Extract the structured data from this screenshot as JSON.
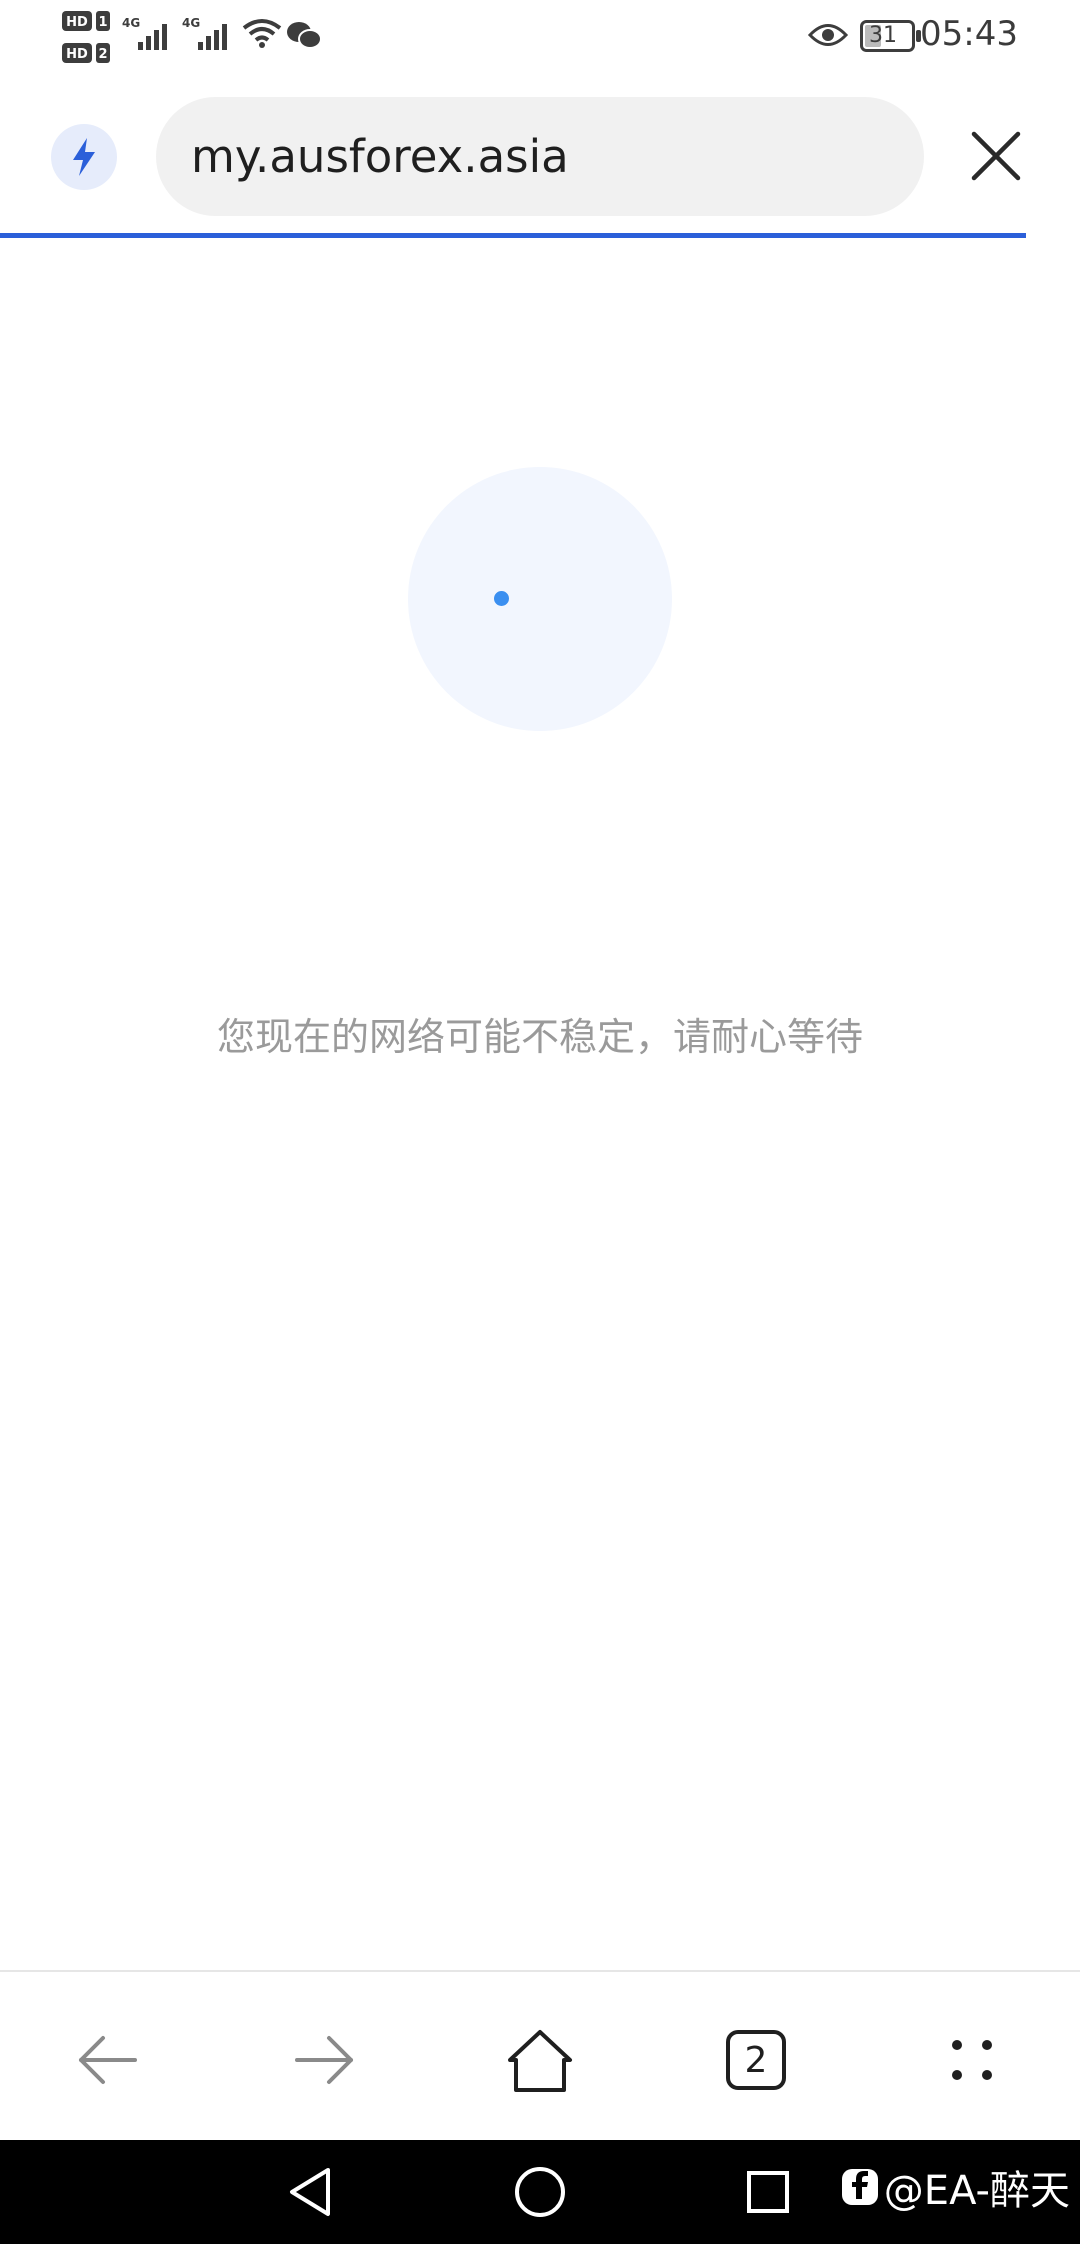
{
  "status_bar": {
    "sim1_label": "HD 1",
    "sim2_label": "HD 2",
    "network1": "4G",
    "network2": "4G",
    "battery": "31",
    "time": "05:43",
    "icons": [
      "signal-icon",
      "wifi-icon",
      "wechat-icon",
      "eye-icon",
      "battery-icon"
    ]
  },
  "address_bar": {
    "url": "my.ausforex.asia",
    "icons": [
      "lightning-icon",
      "close-icon"
    ]
  },
  "loader": {
    "message": "您现在的网络可能不稳定，请耐心等待"
  },
  "bottom_nav": {
    "tabs_count": "2",
    "icons": [
      "back-arrow-icon",
      "forward-arrow-icon",
      "home-icon",
      "tabs-icon",
      "more-icon"
    ]
  },
  "system_nav": {
    "watermark": "@EA-醉天",
    "icons": [
      "back-triangle-icon",
      "home-circle-icon",
      "recents-square-icon"
    ]
  },
  "colors": {
    "accent": "#2b5fd9",
    "loader_dot": "#3b8ff0",
    "url_pill": "#f1f1f1"
  }
}
